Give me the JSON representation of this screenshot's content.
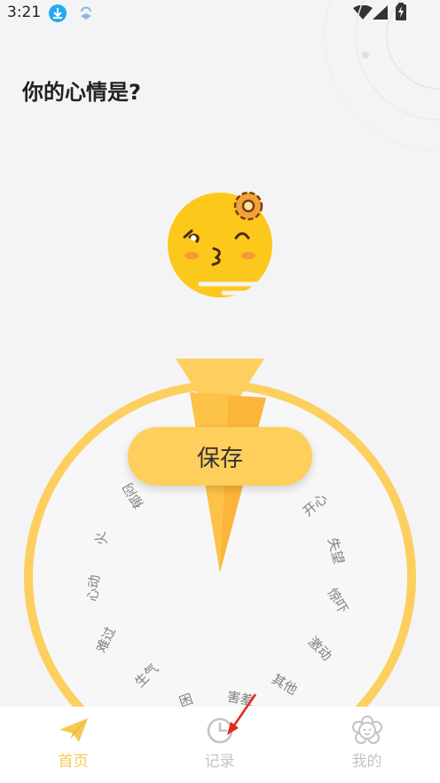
{
  "status": {
    "time": "3:21"
  },
  "page": {
    "title": "你的心情是?"
  },
  "wheel": {
    "moods": [
      "郁闷",
      "火",
      "心动",
      "难过",
      "生气",
      "困",
      "害羞",
      "其他",
      "激动",
      "惊吓",
      "失望",
      "开心"
    ]
  },
  "actions": {
    "save_label": "保存"
  },
  "tabs": [
    {
      "label": "首页",
      "active": true
    },
    {
      "label": "记录",
      "active": false
    },
    {
      "label": "我的",
      "active": false
    }
  ],
  "colors": {
    "accent": "#fecf5b",
    "wheel": "#fdcf5e",
    "active_tab": "#f6c94f",
    "inactive_tab": "#c4c4c4"
  }
}
